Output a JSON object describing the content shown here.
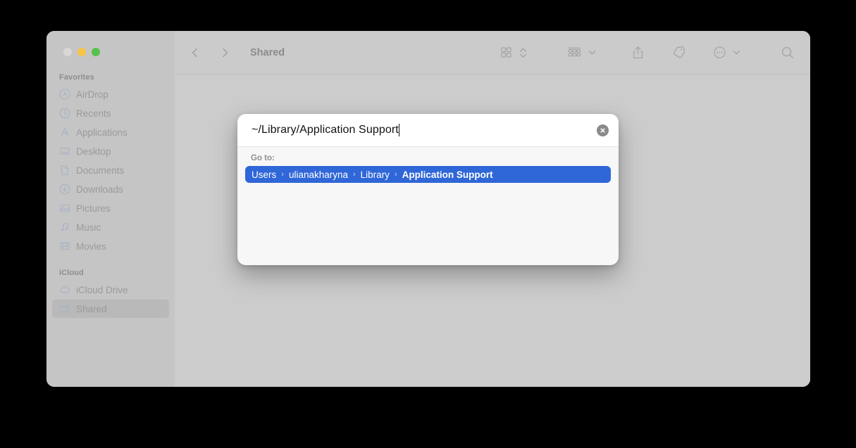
{
  "window": {
    "traffic_lights": [
      "close",
      "minimize",
      "maximize"
    ]
  },
  "sidebar": {
    "groups": [
      {
        "title": "Favorites",
        "items": [
          {
            "label": "AirDrop",
            "icon": "airdrop-icon",
            "selected": false
          },
          {
            "label": "Recents",
            "icon": "clock-icon",
            "selected": false
          },
          {
            "label": "Applications",
            "icon": "applications-icon",
            "selected": false
          },
          {
            "label": "Desktop",
            "icon": "desktop-icon",
            "selected": false
          },
          {
            "label": "Documents",
            "icon": "document-icon",
            "selected": false
          },
          {
            "label": "Downloads",
            "icon": "download-icon",
            "selected": false
          },
          {
            "label": "Pictures",
            "icon": "pictures-icon",
            "selected": false
          },
          {
            "label": "Music",
            "icon": "music-note-icon",
            "selected": false
          },
          {
            "label": "Movies",
            "icon": "movies-icon",
            "selected": false
          }
        ]
      },
      {
        "title": "iCloud",
        "items": [
          {
            "label": "iCloud Drive",
            "icon": "cloud-icon",
            "selected": false
          },
          {
            "label": "Shared",
            "icon": "shared-folder-icon",
            "selected": true
          }
        ]
      }
    ]
  },
  "toolbar": {
    "back_icon": "chevron-left-icon",
    "forward_icon": "chevron-right-icon",
    "title": "Shared",
    "view_icon": "icon-view-icon",
    "view_stepper_icon": "chevron-updown-icon",
    "group_icon": "group-by-icon",
    "group_chevron_icon": "chevron-down-icon",
    "share_icon": "share-icon",
    "tag_icon": "tag-icon",
    "more_icon": "ellipsis-circle-icon",
    "more_chevron_icon": "chevron-down-icon",
    "search_icon": "search-icon"
  },
  "dialog": {
    "name": "go-to-folder",
    "input_value": "~/Library/Application Support",
    "input_placeholder": "Go to the folder:",
    "clear_icon": "clear-circle-icon",
    "go_to_label": "Go to:",
    "suggestion": {
      "crumbs": [
        "Users",
        "ulianakharyna",
        "Library",
        "Application Support"
      ],
      "separator": "›",
      "bold_last": true
    }
  },
  "colors": {
    "accent_blue": "#2F66D8",
    "sidebar_bg": "#C5C5C5",
    "content_bg": "#CCCCCC",
    "toolbar_bg": "#CBCBCB",
    "dialog_bg": "#F7F7F7",
    "input_bg": "#FFFFFF",
    "sidebar_icon": "#A9B4C4",
    "traffic_close": "#D9D8D6",
    "traffic_min": "#F6C344",
    "traffic_max": "#56C14C"
  }
}
